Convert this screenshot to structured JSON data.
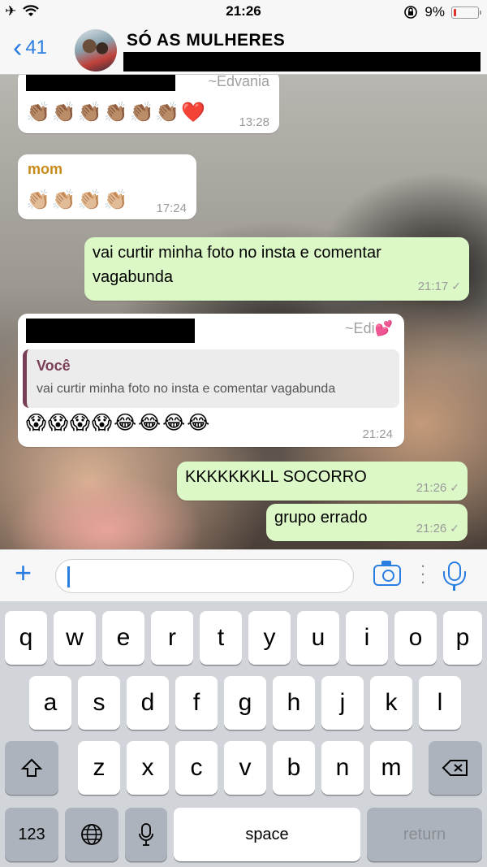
{
  "status_bar": {
    "time": "21:26",
    "battery": "9%",
    "battery_level": 0.09,
    "icons": [
      "airplane-icon",
      "wifi-icon",
      "rotation-lock-icon",
      "battery-icon"
    ]
  },
  "header": {
    "back_count": "41",
    "group_name": "SÓ AS MULHERES",
    "colors": {
      "accent": "#2a7de1"
    }
  },
  "messages": [
    {
      "direction": "in",
      "sender": "~Edvania",
      "text": "👏🏽👏🏽👏🏽👏🏽👏🏽👏🏽❤️",
      "time": "13:28"
    },
    {
      "direction": "in",
      "sender": "mom",
      "text": "👏🏼👏🏼👏🏼👏🏼",
      "time": "17:24"
    },
    {
      "direction": "out",
      "text": "vai curtir minha foto no insta e comentar vagabunda",
      "time": "21:17",
      "status": "✓"
    },
    {
      "direction": "in",
      "sender": "~Edi💕",
      "quote_author": "Você",
      "quote_text": "vai curtir minha foto no insta e comentar vagabunda",
      "text": "😱😱😱😱😂😂😂😂",
      "time": "21:24"
    },
    {
      "direction": "out",
      "text": "KKKKKKKLL SOCORRO",
      "time": "21:26",
      "status": "✓"
    },
    {
      "direction": "out",
      "text": "grupo errado",
      "time": "21:26",
      "status": "✓"
    }
  ],
  "composer": {
    "value": "",
    "icons": [
      "plus-icon",
      "camera-icon",
      "more-icon",
      "microphone-icon"
    ]
  },
  "keyboard": {
    "row1": [
      "q",
      "w",
      "e",
      "r",
      "t",
      "y",
      "u",
      "i",
      "o",
      "p"
    ],
    "row2": [
      "a",
      "s",
      "d",
      "f",
      "g",
      "h",
      "j",
      "k",
      "l"
    ],
    "row3": [
      "z",
      "x",
      "c",
      "v",
      "b",
      "n",
      "m"
    ],
    "numbers_label": "123",
    "space_label": "space",
    "return_label": "return"
  }
}
